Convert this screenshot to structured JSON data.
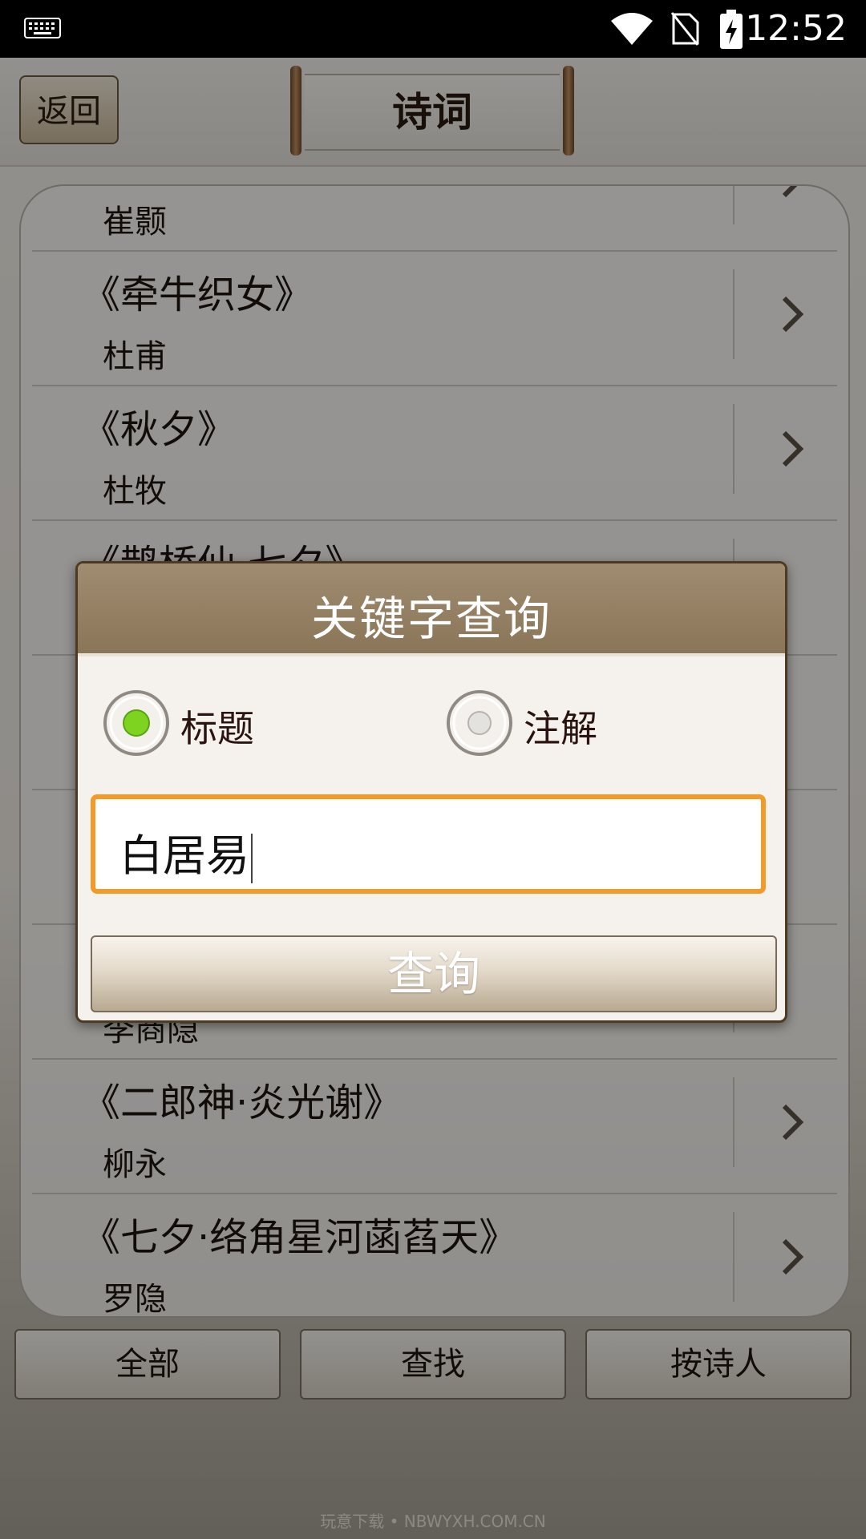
{
  "status_bar": {
    "time": "12:52"
  },
  "header": {
    "back_label": "返回",
    "title": "诗词"
  },
  "list": [
    {
      "title": "",
      "author": "崔颢"
    },
    {
      "title": "《牵牛织女》",
      "author": "杜甫"
    },
    {
      "title": "《秋夕》",
      "author": "杜牧"
    },
    {
      "title": "《鹊桥仙·七夕》",
      "author": ""
    },
    {
      "title": "",
      "author": ""
    },
    {
      "title": "",
      "author": ""
    },
    {
      "title": "",
      "author": "李商隐"
    },
    {
      "title": "《二郎神·炎光谢》",
      "author": "柳永"
    },
    {
      "title": "《七夕·络角星河菡萏天》",
      "author": "罗隐"
    }
  ],
  "bottom_bar": {
    "all_label": "全部",
    "find_label": "查找",
    "by_poet_label": "按诗人"
  },
  "dialog": {
    "title": "关键字查询",
    "radio_title_label": "标题",
    "radio_title_checked": true,
    "radio_note_label": "注解",
    "radio_note_checked": false,
    "input_value": "白居易",
    "submit_label": "查询"
  },
  "watermark": "玩意下载 • NBWYXH.COM.CN",
  "colors": {
    "accent_orange": "#f39a27",
    "dialog_header": "#8a7558",
    "radio_green": "#7ed321"
  }
}
